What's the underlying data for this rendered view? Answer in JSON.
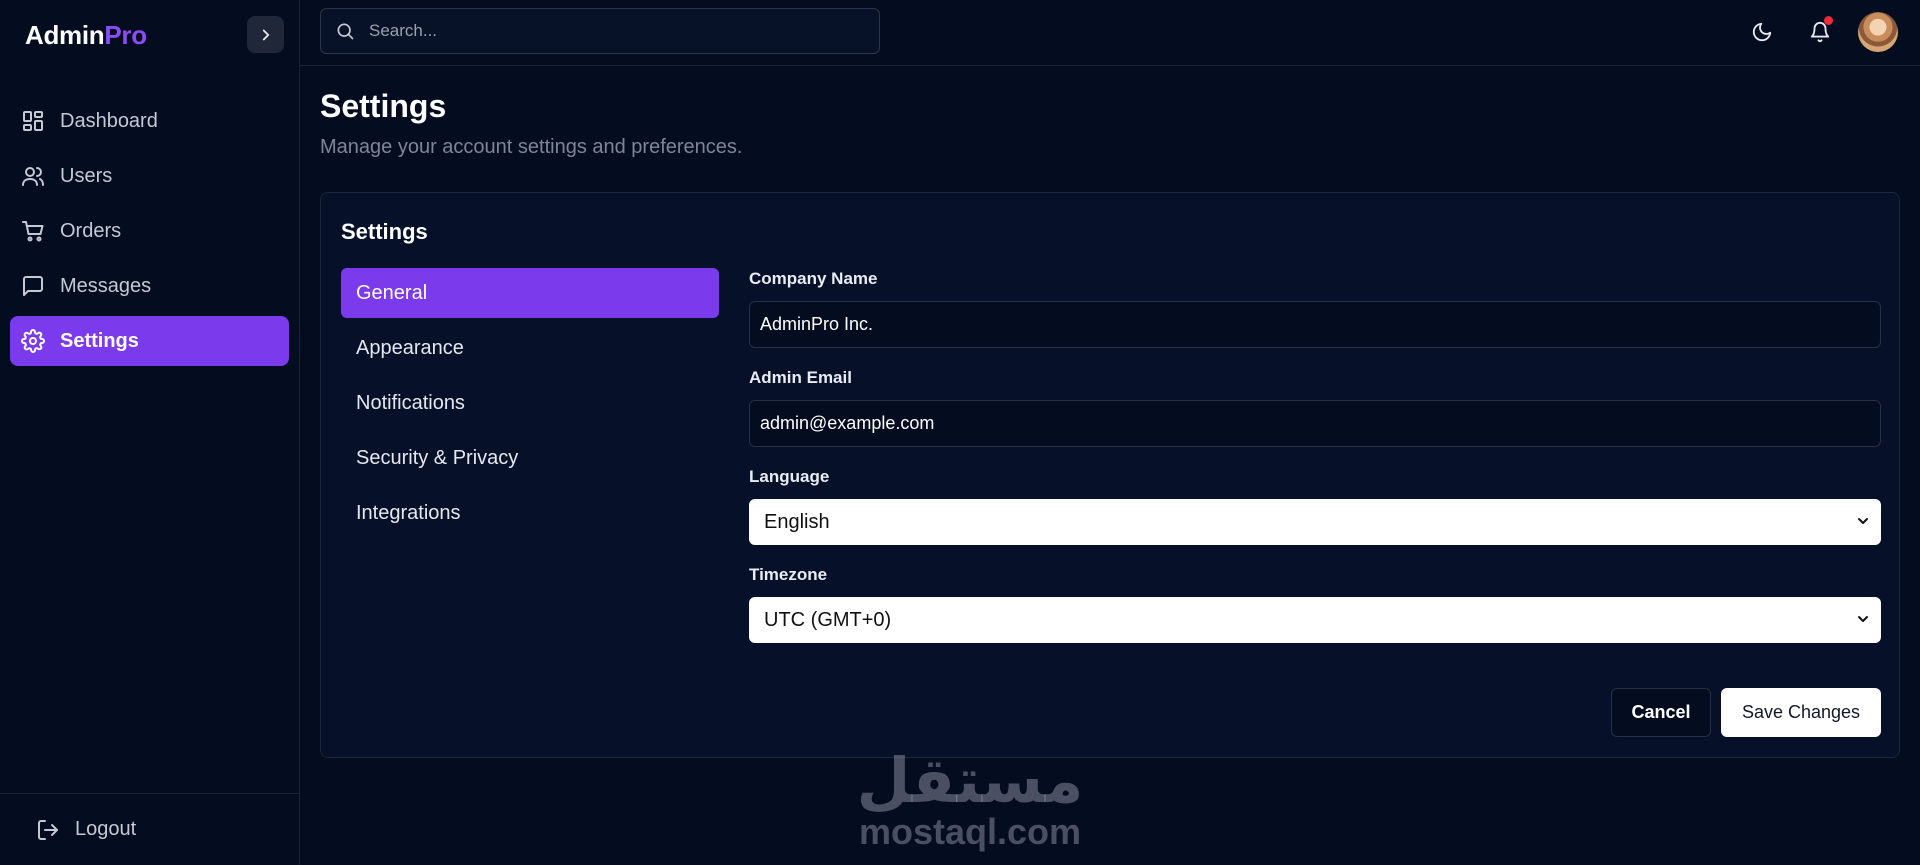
{
  "brand": {
    "name_part1": "Admin",
    "name_part2": "Pro"
  },
  "sidebar": {
    "items": [
      {
        "label": "Dashboard",
        "icon": "dashboard-icon"
      },
      {
        "label": "Users",
        "icon": "users-icon"
      },
      {
        "label": "Orders",
        "icon": "cart-icon"
      },
      {
        "label": "Messages",
        "icon": "message-icon"
      },
      {
        "label": "Settings",
        "icon": "gear-icon",
        "active": true
      }
    ],
    "logout_label": "Logout"
  },
  "topbar": {
    "search_placeholder": "Search...",
    "icons": [
      "moon-icon",
      "bell-icon",
      "avatar"
    ]
  },
  "page": {
    "title": "Settings",
    "subtitle": "Manage your account settings and preferences."
  },
  "card": {
    "title": "Settings",
    "tabs": [
      {
        "label": "General",
        "active": true
      },
      {
        "label": "Appearance"
      },
      {
        "label": "Notifications"
      },
      {
        "label": "Security & Privacy"
      },
      {
        "label": "Integrations"
      }
    ],
    "form": {
      "company_name_label": "Company Name",
      "company_name_value": "AdminPro Inc.",
      "admin_email_label": "Admin Email",
      "admin_email_value": "admin@example.com",
      "language_label": "Language",
      "language_value": "English",
      "timezone_label": "Timezone",
      "timezone_value": "UTC (GMT+0)"
    },
    "actions": {
      "cancel_label": "Cancel",
      "save_label": "Save Changes"
    }
  },
  "watermark": {
    "arabic": "مستقل",
    "latin": "mostaql.com"
  },
  "colors": {
    "accent": "#7c3aed",
    "background": "#040c1f",
    "notification_dot": "#ef2b3a"
  }
}
